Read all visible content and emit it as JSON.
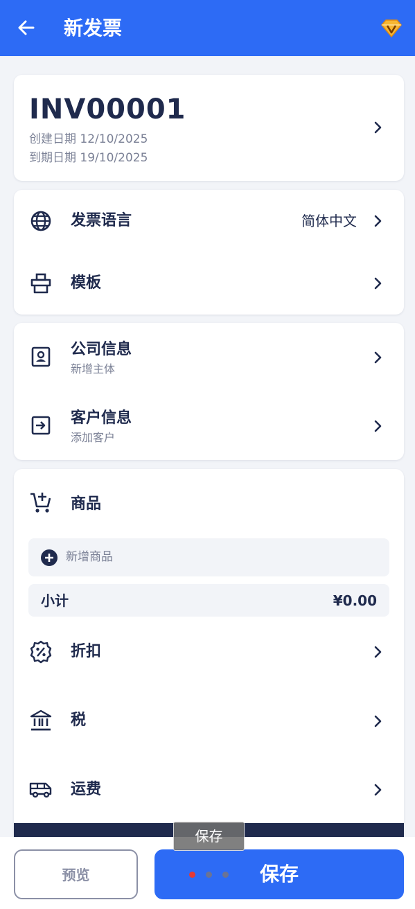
{
  "appbar": {
    "title": "新发票",
    "back_icon": "arrow-left-icon",
    "premium_icon": "diamond-icon"
  },
  "invoice": {
    "number": "INV00001",
    "created_label": "创建日期 12/10/2025",
    "due_label": "到期日期 19/10/2025"
  },
  "settings": {
    "language_label": "发票语言",
    "language_value": "简体中文",
    "template_label": "模板"
  },
  "info": {
    "company_label": "公司信息",
    "company_sub": "新增主体",
    "client_label": "客户信息",
    "client_sub": "添加客户"
  },
  "items": {
    "title": "商品",
    "add_placeholder": "新增商品",
    "subtotal_label": "小计",
    "subtotal_value": "¥0.00",
    "discount_label": "折扣",
    "tax_label": "税",
    "shipping_label": "运费"
  },
  "toast": {
    "text": "保存"
  },
  "bottom": {
    "preview_label": "预览",
    "save_label": "保存"
  },
  "colors": {
    "primary": "#2d6bf5",
    "navy": "#1f2a4d",
    "muted": "#7b8196",
    "loading_dot_active": "#e53935",
    "loading_dot": "#6b7394"
  }
}
